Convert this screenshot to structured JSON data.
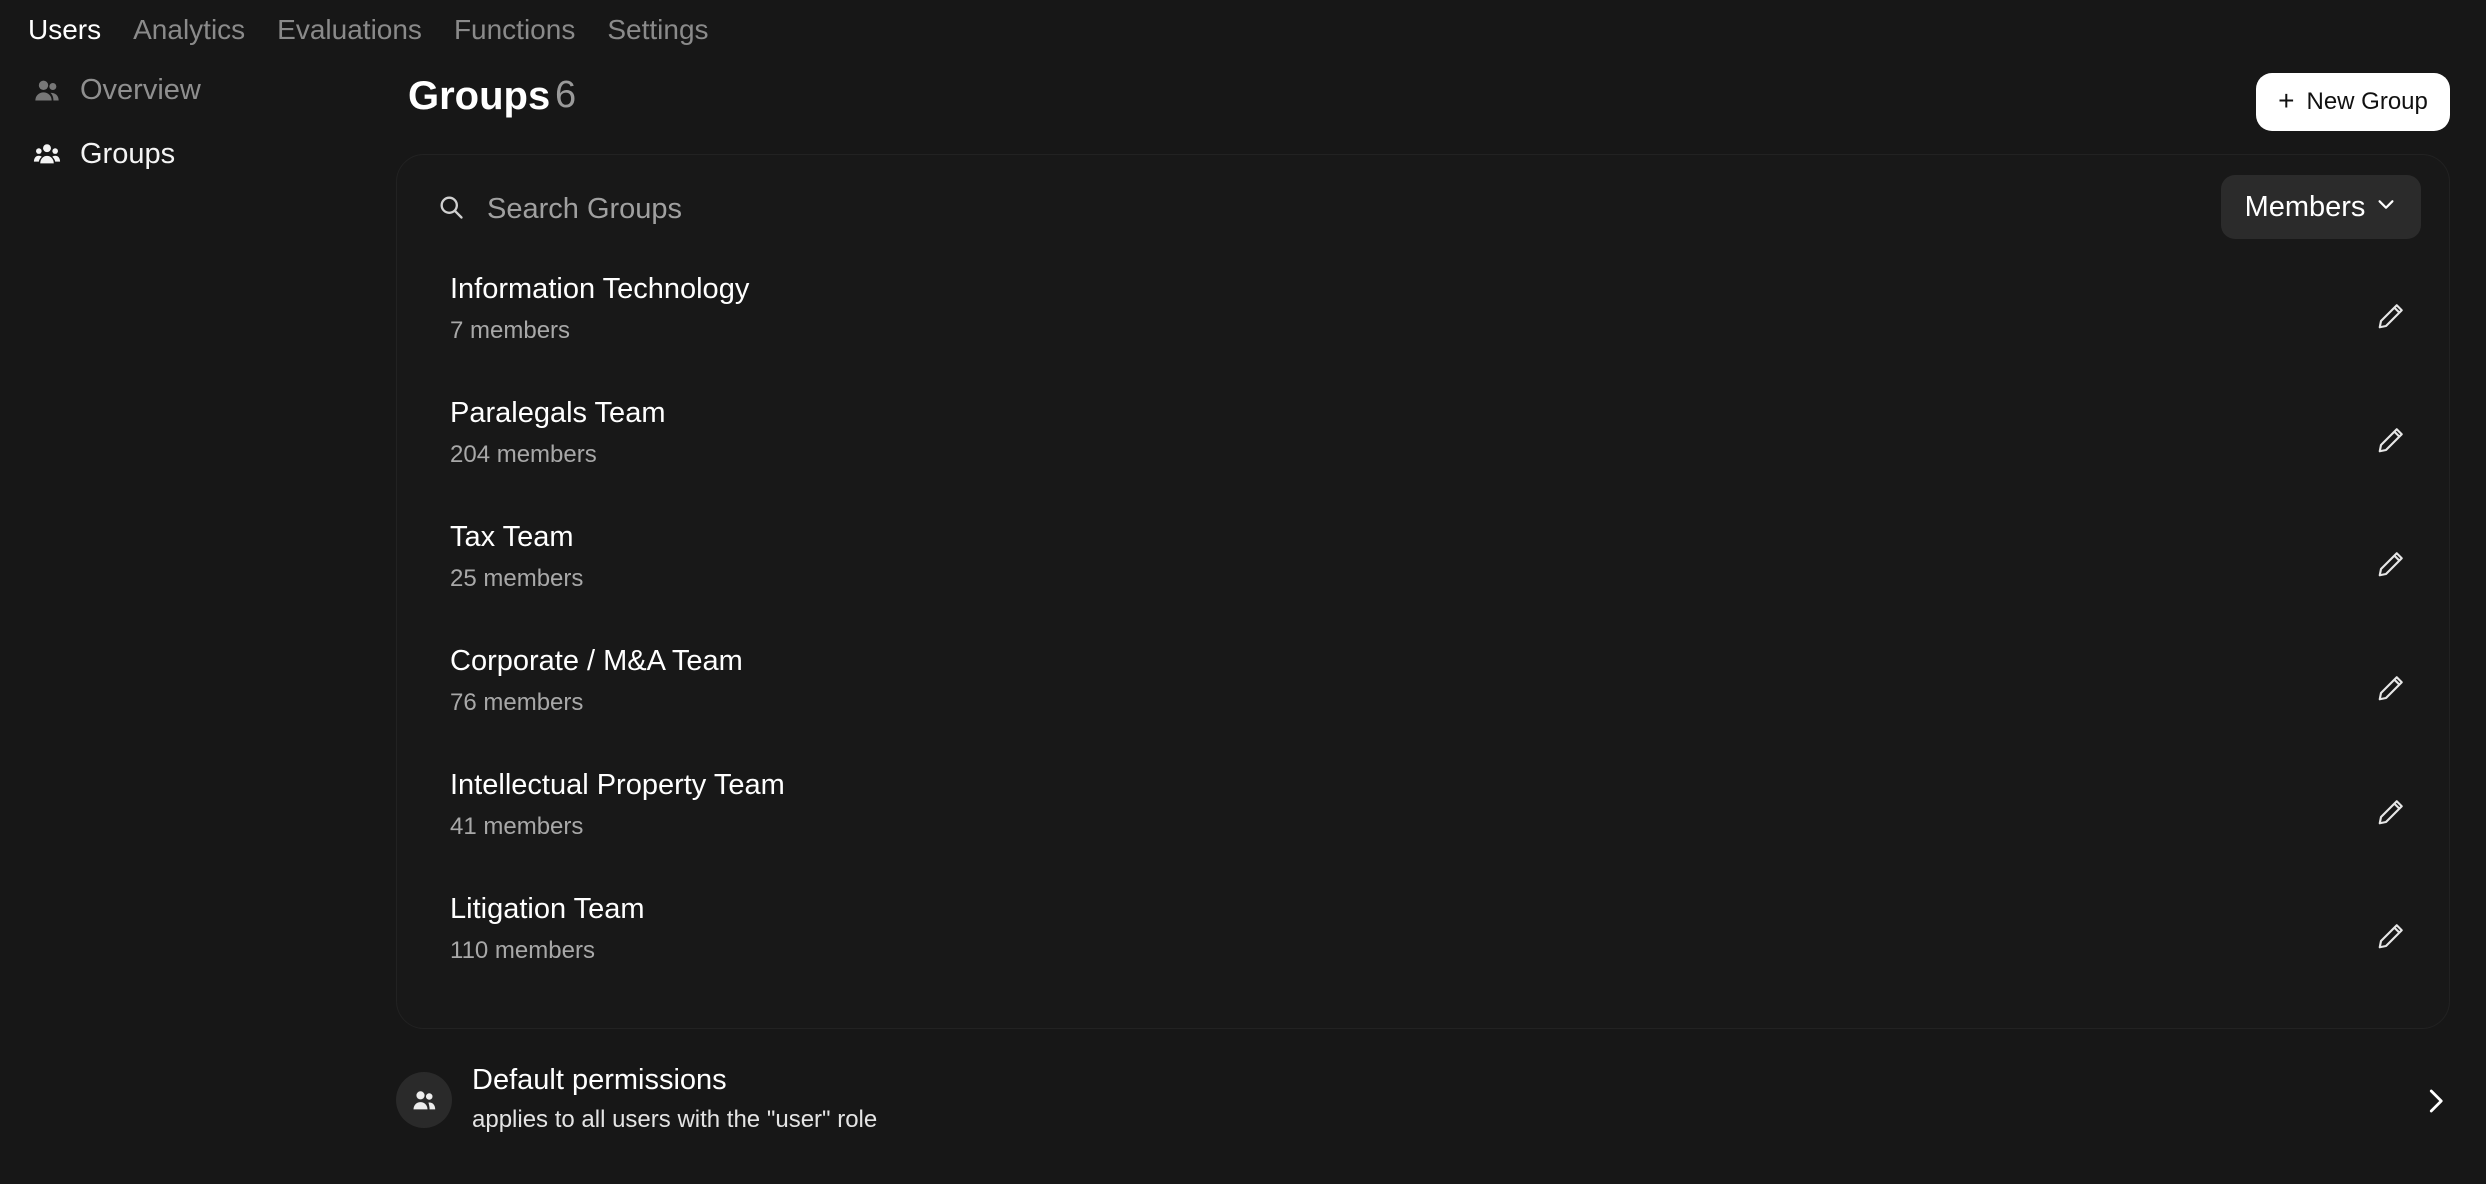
{
  "top_nav": {
    "tabs": [
      {
        "label": "Users",
        "active": true
      },
      {
        "label": "Analytics",
        "active": false
      },
      {
        "label": "Evaluations",
        "active": false
      },
      {
        "label": "Functions",
        "active": false
      },
      {
        "label": "Settings",
        "active": false
      }
    ]
  },
  "sidebar": {
    "items": [
      {
        "label": "Overview",
        "icon": "users-icon",
        "active": false
      },
      {
        "label": "Groups",
        "icon": "group-icon",
        "active": true
      }
    ]
  },
  "main": {
    "title": "Groups",
    "count": "6",
    "new_group_label": "New Group",
    "search": {
      "placeholder": "Search Groups",
      "value": ""
    },
    "sort_dropdown": {
      "selected": "Members"
    },
    "groups": [
      {
        "name": "Information Technology",
        "members": "7 members"
      },
      {
        "name": "Paralegals Team",
        "members": "204 members"
      },
      {
        "name": "Tax Team",
        "members": "25 members"
      },
      {
        "name": "Corporate / M&A Team",
        "members": "76 members"
      },
      {
        "name": "Intellectual Property Team",
        "members": "41 members"
      },
      {
        "name": "Litigation Team",
        "members": "110 members"
      }
    ],
    "default_permissions": {
      "title": "Default permissions",
      "description": "applies to all users with the \"user\" role"
    }
  },
  "colors": {
    "background": "#171717",
    "card_background": "#181818",
    "active_text": "#ffffff",
    "inactive_text": "#8a8a8a",
    "button_background": "#ffffff",
    "dropdown_background": "#2b2b2b"
  }
}
